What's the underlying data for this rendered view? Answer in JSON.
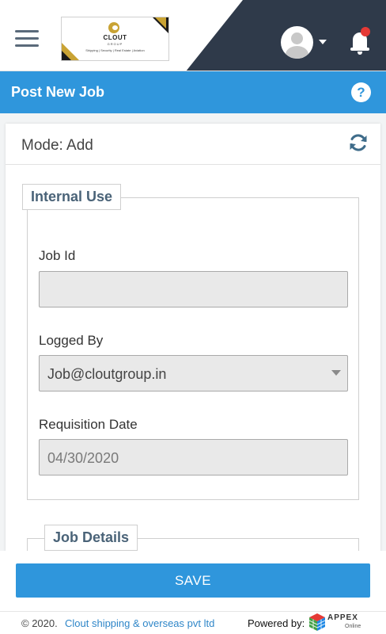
{
  "header": {
    "logo": {
      "name": "CLOUT",
      "group": "GROUP",
      "tagline": "Shipping | Security | Real Estate | Aviation"
    },
    "colors": {
      "dark_panel": "#2f3a4a",
      "notification_dot": "#e53935"
    }
  },
  "titlebar": {
    "title": "Post New Job",
    "help_glyph": "?",
    "color": "#2f96dc"
  },
  "card": {
    "mode_label": "Mode: Add"
  },
  "internal_use": {
    "legend": "Internal Use",
    "job_id": {
      "label": "Job Id",
      "value": ""
    },
    "logged_by": {
      "label": "Logged By",
      "value": "Job@cloutgroup.in"
    },
    "requisition_date": {
      "label": "Requisition Date",
      "value": "04/30/2020"
    }
  },
  "job_details": {
    "legend": "Job Details"
  },
  "actions": {
    "save_label": "SAVE"
  },
  "footer": {
    "copyright": "© 2020.",
    "company": "Clout shipping & overseas pvt ltd",
    "powered_by": "Powered by:",
    "brand": "APPEX",
    "brand_sub": "Online"
  },
  "icons": [
    "menu-icon",
    "user-avatar-icon",
    "dropdown-caret-icon",
    "bell-icon",
    "help-icon",
    "refresh-icon",
    "select-arrow-icon",
    "appex-cube-icon"
  ]
}
